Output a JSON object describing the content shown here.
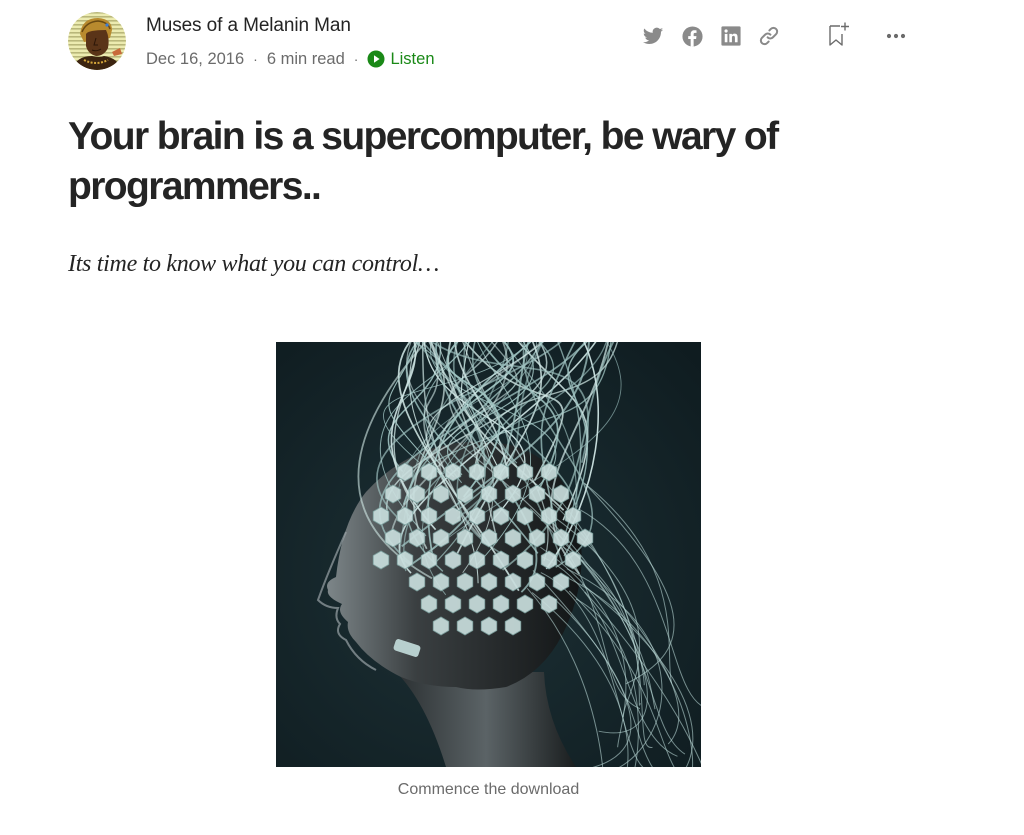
{
  "author": {
    "name": "Muses of a Melanin Man",
    "avatar_icon": "author-avatar"
  },
  "meta": {
    "date": "Dec 16, 2016",
    "separator": "·",
    "read_time": "6 min read",
    "listen_label": "Listen",
    "listen_icon": "play-circle-icon"
  },
  "actions": {
    "share": [
      {
        "name": "twitter",
        "icon": "twitter-icon"
      },
      {
        "name": "facebook",
        "icon": "facebook-icon"
      },
      {
        "name": "linkedin",
        "icon": "linkedin-icon"
      },
      {
        "name": "copy-link",
        "icon": "link-icon"
      }
    ],
    "bookmark_icon": "bookmark-add-icon",
    "more_icon": "more-horizontal-icon"
  },
  "article": {
    "title": "Your brain is a supercomputer, be wary of programmers..",
    "subtitle": "Its time to know what you can control…",
    "figure": {
      "alt": "Profile of a man's head covered in hexagonal EEG electrodes with many white wires rising upward",
      "caption": "Commence the download"
    }
  },
  "colors": {
    "text_primary": "#242424",
    "text_secondary": "#6b6b6b",
    "accent_green": "#1a8917",
    "icon_gray": "#8a8a8a",
    "image_background": "#132226"
  }
}
